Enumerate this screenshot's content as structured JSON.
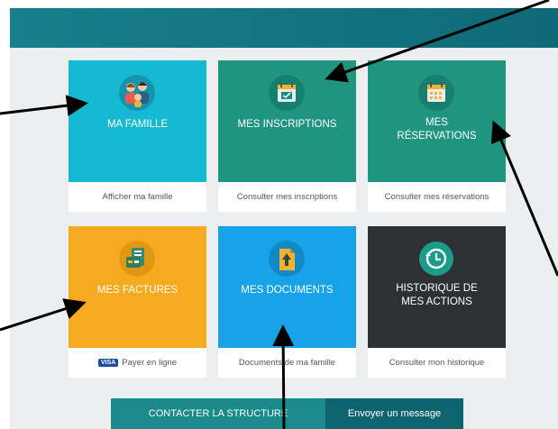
{
  "tiles": [
    {
      "label": "MA FAMILLE",
      "link": "Afficher ma famille",
      "color": "#15b9d1",
      "icon": "family-icon"
    },
    {
      "label": "MES INSCRIPTIONS",
      "link": "Consulter mes inscriptions",
      "color": "#1f9580",
      "icon": "calendar-check-icon"
    },
    {
      "label": "MES\nRÉSERVATIONS",
      "label_line1": "MES",
      "label_line2": "RÉSERVATIONS",
      "link": "Consulter mes réservations",
      "color": "#1f9580",
      "icon": "calendar-grid-icon"
    },
    {
      "label": "MES FACTURES",
      "link": "Payer en ligne",
      "link_badge": "VISA",
      "color": "#f5aa1f",
      "icon": "invoice-icon"
    },
    {
      "label": "MES DOCUMENTS",
      "link": "Documents de ma famille",
      "color": "#18a3e8",
      "icon": "document-upload-icon"
    },
    {
      "label": "HISTORIQUE DE\nMES ACTIONS",
      "label_line1": "HISTORIQUE DE",
      "label_line2": "MES ACTIONS",
      "link": "Consulter mon historique",
      "color": "#2d3133",
      "icon": "history-icon"
    }
  ],
  "actions": {
    "contact": "CONTACTER LA STRUCTURE",
    "message": "Envoyer un message"
  }
}
